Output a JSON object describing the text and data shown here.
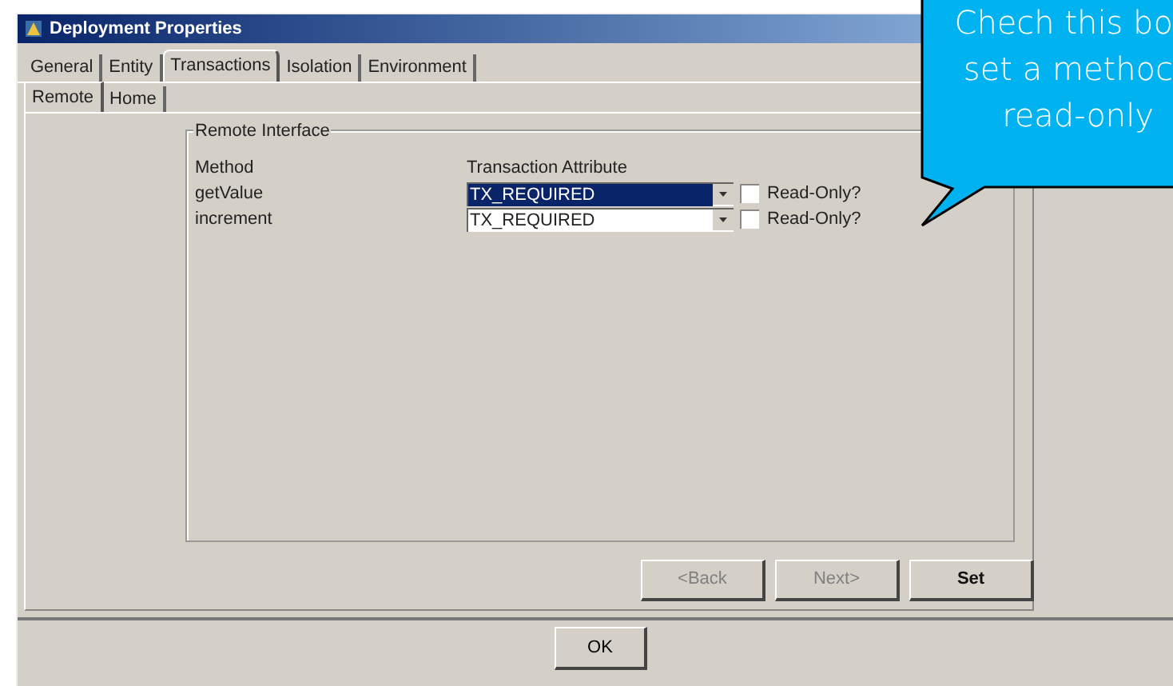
{
  "window": {
    "title": "Deployment Properties"
  },
  "tabs": [
    {
      "label": "General",
      "selected": false
    },
    {
      "label": "Entity",
      "selected": false
    },
    {
      "label": "Transactions",
      "selected": true
    },
    {
      "label": "Isolation",
      "selected": false
    },
    {
      "label": "Environment",
      "selected": false
    }
  ],
  "subtabs": [
    {
      "label": "Remote",
      "selected": true
    },
    {
      "label": "Home",
      "selected": false
    }
  ],
  "group": {
    "title": "Remote Interface",
    "columns": [
      "Method",
      "Transaction Attribute"
    ],
    "rows": [
      {
        "method": "getValue",
        "attribute": "TX_REQUIRED",
        "selected": true,
        "readonly_label": "Read-Only?",
        "checked": false
      },
      {
        "method": "increment",
        "attribute": "TX_REQUIRED",
        "selected": false,
        "readonly_label": "Read-Only?",
        "checked": false
      }
    ]
  },
  "buttons": [
    {
      "label": "<Back",
      "disabled": true
    },
    {
      "label": "Next>",
      "disabled": true
    },
    {
      "label": "Set",
      "disabled": false
    }
  ],
  "ok_button": "OK",
  "callout": {
    "lines": [
      "Chech this bo",
      "set a methoc",
      "read-only"
    ]
  }
}
